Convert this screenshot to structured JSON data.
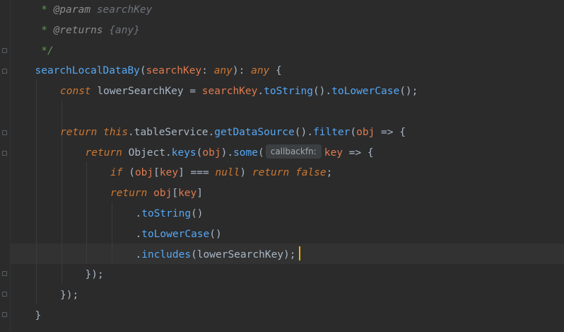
{
  "editor": {
    "language": "TypeScript",
    "lines": [
      {
        "indent": 1,
        "tokens": [
          {
            "t": " * ",
            "c": "doc"
          },
          {
            "t": "@param",
            "c": "doc-tag"
          },
          {
            "t": " searchKey",
            "c": "doc-val"
          }
        ]
      },
      {
        "indent": 1,
        "tokens": [
          {
            "t": " * ",
            "c": "doc"
          },
          {
            "t": "@returns",
            "c": "doc-tag"
          },
          {
            "t": " {any}",
            "c": "doc-val"
          }
        ]
      },
      {
        "indent": 1,
        "tokens": [
          {
            "t": " */",
            "c": "doc"
          }
        ]
      },
      {
        "indent": 1,
        "tokens": [
          {
            "t": "searchLocalDataBy",
            "c": "fn"
          },
          {
            "t": "(",
            "c": "punc"
          },
          {
            "t": "searchKey",
            "c": "param"
          },
          {
            "t": ": ",
            "c": "punc"
          },
          {
            "t": "any",
            "c": "type"
          },
          {
            "t": "): ",
            "c": "punc"
          },
          {
            "t": "any",
            "c": "type"
          },
          {
            "t": " {",
            "c": "punc"
          }
        ]
      },
      {
        "indent": 2,
        "tokens": [
          {
            "t": "const",
            "c": "kw"
          },
          {
            "t": " lowerSearchKey = ",
            "c": "id"
          },
          {
            "t": "searchKey",
            "c": "param"
          },
          {
            "t": ".",
            "c": "punc"
          },
          {
            "t": "toString",
            "c": "prop"
          },
          {
            "t": "().",
            "c": "punc"
          },
          {
            "t": "toLowerCase",
            "c": "prop"
          },
          {
            "t": "();",
            "c": "punc"
          }
        ]
      },
      {
        "indent": 2,
        "tokens": []
      },
      {
        "indent": 2,
        "tokens": [
          {
            "t": "return",
            "c": "kw"
          },
          {
            "t": " ",
            "c": "id"
          },
          {
            "t": "this",
            "c": "kw"
          },
          {
            "t": ".tableService.",
            "c": "id"
          },
          {
            "t": "getDataSource",
            "c": "prop"
          },
          {
            "t": "().",
            "c": "punc"
          },
          {
            "t": "filter",
            "c": "prop"
          },
          {
            "t": "(",
            "c": "punc"
          },
          {
            "t": "obj",
            "c": "obj"
          },
          {
            "t": " => {",
            "c": "punc"
          }
        ]
      },
      {
        "indent": 3,
        "tokens": [
          {
            "t": "return",
            "c": "kw"
          },
          {
            "t": " Object.",
            "c": "id"
          },
          {
            "t": "keys",
            "c": "prop"
          },
          {
            "t": "(",
            "c": "punc"
          },
          {
            "t": "obj",
            "c": "obj"
          },
          {
            "t": ").",
            "c": "punc"
          },
          {
            "t": "some",
            "c": "prop"
          },
          {
            "t": "(",
            "c": "punc"
          },
          {
            "t": "callbackfn:",
            "c": "hint"
          },
          {
            "t": "key",
            "c": "obj"
          },
          {
            "t": " => {",
            "c": "punc"
          }
        ]
      },
      {
        "indent": 4,
        "tokens": [
          {
            "t": "if",
            "c": "kw"
          },
          {
            "t": " (",
            "c": "punc"
          },
          {
            "t": "obj",
            "c": "obj"
          },
          {
            "t": "[",
            "c": "punc"
          },
          {
            "t": "key",
            "c": "obj"
          },
          {
            "t": "] === ",
            "c": "punc"
          },
          {
            "t": "null",
            "c": "kw"
          },
          {
            "t": ") ",
            "c": "punc"
          },
          {
            "t": "return",
            "c": "kw"
          },
          {
            "t": " ",
            "c": "id"
          },
          {
            "t": "false",
            "c": "kw"
          },
          {
            "t": ";",
            "c": "punc"
          }
        ]
      },
      {
        "indent": 4,
        "tokens": [
          {
            "t": "return",
            "c": "kw"
          },
          {
            "t": " ",
            "c": "id"
          },
          {
            "t": "obj",
            "c": "obj"
          },
          {
            "t": "[",
            "c": "punc"
          },
          {
            "t": "key",
            "c": "obj"
          },
          {
            "t": "]",
            "c": "punc"
          }
        ]
      },
      {
        "indent": 5,
        "tokens": [
          {
            "t": ".",
            "c": "punc"
          },
          {
            "t": "toString",
            "c": "prop"
          },
          {
            "t": "()",
            "c": "punc"
          }
        ]
      },
      {
        "indent": 5,
        "tokens": [
          {
            "t": ".",
            "c": "punc"
          },
          {
            "t": "toLowerCase",
            "c": "prop"
          },
          {
            "t": "()",
            "c": "punc"
          }
        ]
      },
      {
        "indent": 5,
        "tokens": [
          {
            "t": ".",
            "c": "punc"
          },
          {
            "t": "includes",
            "c": "prop"
          },
          {
            "t": "(lowerSearchKey);",
            "c": "punc"
          }
        ]
      },
      {
        "indent": 3,
        "tokens": [
          {
            "t": "});",
            "c": "punc"
          }
        ]
      },
      {
        "indent": 2,
        "tokens": [
          {
            "t": "});",
            "c": "punc"
          }
        ]
      },
      {
        "indent": 1,
        "tokens": [
          {
            "t": "}",
            "c": "punc"
          }
        ]
      }
    ]
  },
  "colors": {
    "background": "#2b2b2b",
    "current_line": "#323232",
    "caret": "#f2b600",
    "keyword": "#cc7832",
    "function": "#56a8f5",
    "parameter": "#e07a4f",
    "doc_comment": "#629755"
  },
  "icons": {
    "fold_marker": "fold-marker-icon",
    "caret": "text-caret"
  }
}
